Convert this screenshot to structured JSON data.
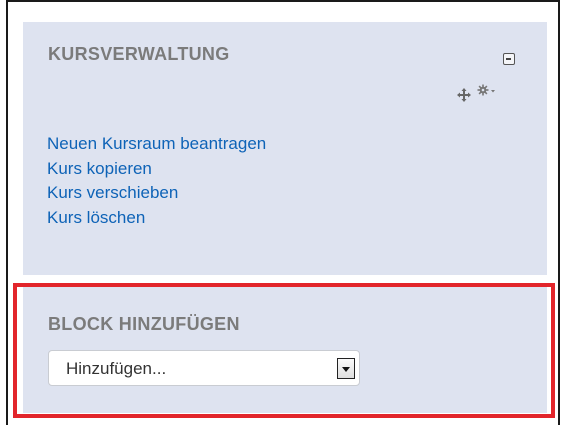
{
  "course_admin_block": {
    "title": "KURSVERWALTUNG",
    "collapse_icon": "collapse-icon",
    "move_icon": "move-icon",
    "settings_icon": "gear-icon",
    "links": [
      {
        "label": "Neuen Kursraum beantragen"
      },
      {
        "label": "Kurs kopieren"
      },
      {
        "label": "Kurs verschieben"
      },
      {
        "label": "Kurs löschen"
      }
    ]
  },
  "add_block": {
    "title": "BLOCK HINZUFÜGEN",
    "select": {
      "selected": "Hinzufügen..."
    },
    "highlight_color": "#e2252b"
  },
  "colors": {
    "block_background": "#dee3f0",
    "link": "#0e63b7",
    "heading": "#7b7b7b"
  }
}
